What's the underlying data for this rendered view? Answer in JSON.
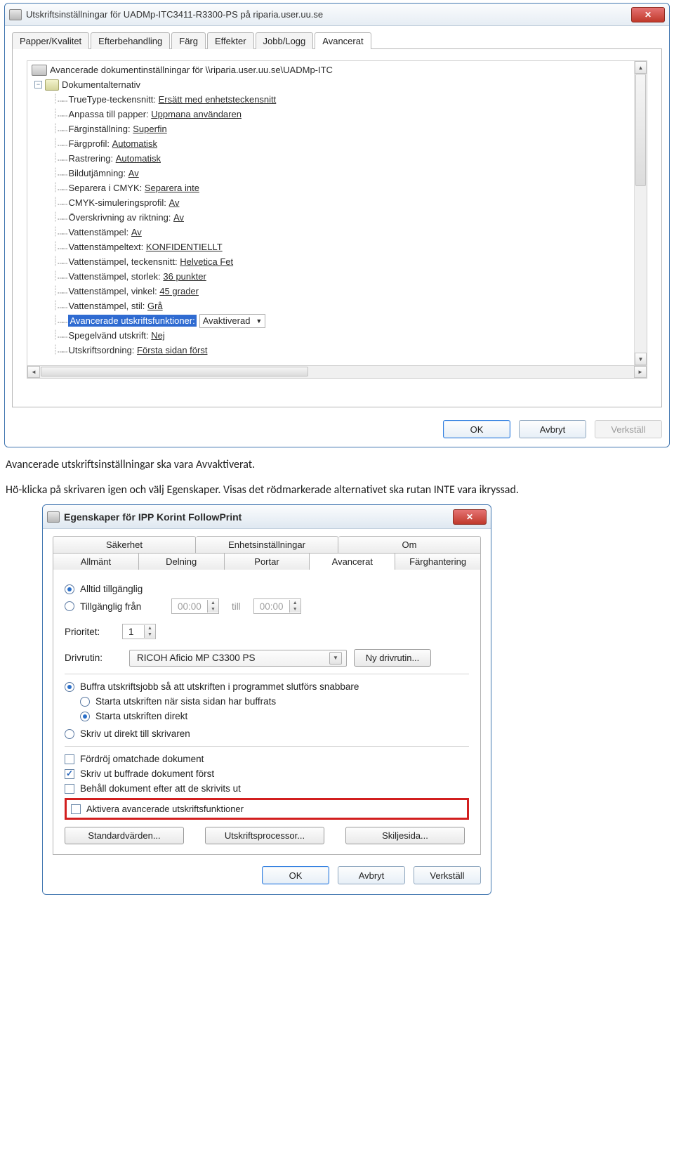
{
  "win1": {
    "title": "Utskriftsinställningar för UADMp-ITC3411-R3300-PS på riparia.user.uu.se",
    "tabs": [
      "Papper/Kvalitet",
      "Efterbehandling",
      "Färg",
      "Effekter",
      "Jobb/Logg",
      "Avancerat"
    ],
    "root_label": "Avancerade dokumentinställningar för \\\\riparia.user.uu.se\\UADMp-ITC",
    "doc_options_label": "Dokumentalternativ",
    "items": [
      {
        "k": "TrueType-teckensnitt:",
        "v": "Ersätt med enhetsteckensnitt"
      },
      {
        "k": "Anpassa till papper:",
        "v": "Uppmana användaren"
      },
      {
        "k": "Färginställning:",
        "v": "Superfin"
      },
      {
        "k": "Färgprofil:",
        "v": "Automatisk"
      },
      {
        "k": "Rastrering:",
        "v": "Automatisk"
      },
      {
        "k": "Bildutjämning:",
        "v": "Av"
      },
      {
        "k": "Separera i CMYK:",
        "v": "Separera inte"
      },
      {
        "k": "CMYK-simuleringsprofil:",
        "v": "Av"
      },
      {
        "k": "Överskrivning av riktning:",
        "v": "Av"
      },
      {
        "k": "Vattenstämpel:",
        "v": "Av"
      },
      {
        "k": "Vattenstämpeltext:",
        "v": "KONFIDENTIELLT"
      },
      {
        "k": "Vattenstämpel, teckensnitt:",
        "v": "Helvetica Fet"
      },
      {
        "k": "Vattenstämpel, storlek:",
        "v": "36 punkter"
      },
      {
        "k": "Vattenstämpel, vinkel:",
        "v": "45 grader"
      },
      {
        "k": "Vattenstämpel, stil:",
        "v": "Grå"
      }
    ],
    "selected_label": "Avancerade utskriftsfunktioner:",
    "selected_value": "Avaktiverad",
    "after1": {
      "k": "Spegelvänd utskrift:",
      "v": "Nej"
    },
    "after2": {
      "k": "Utskriftsordning:",
      "v": "Första sidan först"
    },
    "ok": "OK",
    "cancel": "Avbryt",
    "apply": "Verkställ"
  },
  "doc1": "Avancerade utskriftsinställningar ska vara Avvaktiverat.",
  "doc2": "Hö-klicka på skrivaren igen och välj Egenskaper. Visas det rödmarkerade alternativet ska rutan INTE vara ikryssad.",
  "win2": {
    "title": "Egenskaper för IPP Korint FollowPrint",
    "tabs_top": [
      "Säkerhet",
      "Enhetsinställningar",
      "Om"
    ],
    "tabs_bot": [
      "Allmänt",
      "Delning",
      "Portar",
      "Avancerat",
      "Färghantering"
    ],
    "always": "Alltid tillgänglig",
    "avail_from": "Tillgänglig från",
    "time1": "00:00",
    "till": "till",
    "time2": "00:00",
    "priority_label": "Prioritet:",
    "priority_val": "1",
    "driver_label": "Drivrutin:",
    "driver_val": "RICOH Aficio MP C3300 PS",
    "new_driver": "Ny drivrutin...",
    "spool_faster": "Buffra utskriftsjobb så att utskriften i programmet slutförs snabbare",
    "start_after": "Starta utskriften när sista sidan har buffrats",
    "start_direct": "Starta utskriften direkt",
    "print_direct": "Skriv ut direkt till skrivaren",
    "hold_mismatched": "Fördröj omatchade dokument",
    "print_spooled_first": "Skriv ut buffrade dokument först",
    "keep_printed": "Behåll dokument efter att de skrivits ut",
    "enable_advanced": "Aktivera avancerade utskriftsfunktioner",
    "defaults": "Standardvärden...",
    "processor": "Utskriftsprocessor...",
    "separator": "Skiljesida...",
    "ok": "OK",
    "cancel": "Avbryt",
    "apply": "Verkställ"
  }
}
